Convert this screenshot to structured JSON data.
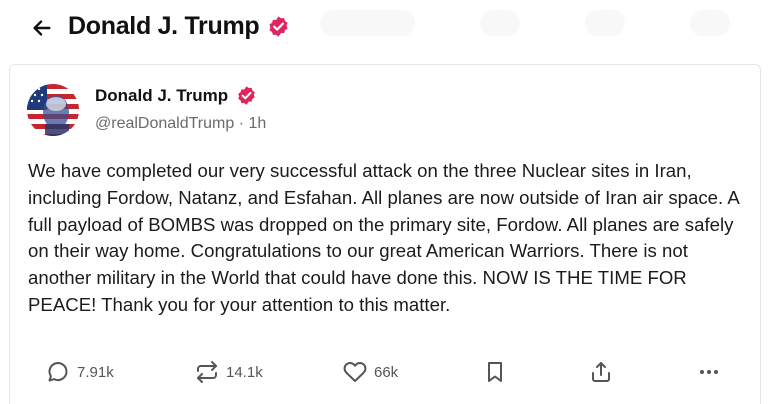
{
  "header": {
    "title": "Donald J. Trump",
    "back_icon": "arrow-left-icon",
    "verified_icon": "verified-badge-icon"
  },
  "post": {
    "author": {
      "name": "Donald J. Trump",
      "handle": "@realDonaldTrump",
      "separator": "·",
      "time": "1h",
      "verified_icon": "verified-badge-icon",
      "avatar": "avatar-flag-portrait"
    },
    "body": "We have completed our very successful attack on the three Nuclear sites in Iran, including Fordow, Natanz, and Esfahan. All planes are now outside of Iran air space. A full payload of BOMBS was dropped on the primary site, Fordow. All planes are safely on their way home. Congratulations to our great American Warriors. There is not another military in the World that could have done this. NOW IS THE TIME FOR PEACE! Thank you for your attention to this matter.",
    "actions": {
      "replies": "7.91k",
      "retruths": "14.1k",
      "likes": "66k"
    }
  },
  "colors": {
    "verified": "#e0245e",
    "text": "#1b1b1b",
    "muted": "#6b6b6b",
    "border": "#e6e6e6"
  }
}
